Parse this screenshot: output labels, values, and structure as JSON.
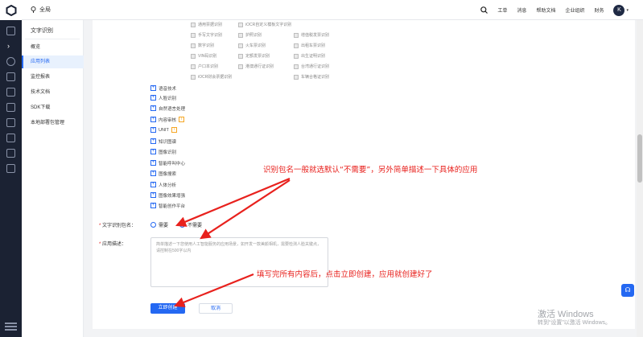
{
  "topbar": {
    "region": "全局",
    "nav": [
      "工单",
      "消息",
      "帮助文档",
      "企业组织",
      "财务"
    ],
    "avatar": "K"
  },
  "sidemenu": {
    "title": "文字识别",
    "items": [
      {
        "label": "概览",
        "active": false
      },
      {
        "label": "应用列表",
        "active": true
      },
      {
        "label": "监控报表",
        "active": false
      },
      {
        "label": "技术文档",
        "active": false
      },
      {
        "label": "SDK下载",
        "active": false
      },
      {
        "label": "本地部署包管理",
        "active": false
      }
    ]
  },
  "ocr_options": [
    [
      "通用票据识别",
      "iOCR自定义模板文字识别"
    ],
    [
      "手写文字识别",
      "护照识别",
      "增值税发票识别"
    ],
    [
      "数字识别",
      "火车票识别",
      "出租车票识别"
    ],
    [
      "VIN码识别",
      "定额发票识别",
      "出生证明识别"
    ],
    [
      "户口本识别",
      "港澳通行证识别",
      "台湾通行证识别"
    ],
    [
      "iOCR财会票据识别",
      "",
      "车辆合格证识别"
    ]
  ],
  "tree_items": [
    {
      "label": "语音技术",
      "tag": ""
    },
    {
      "label": "人脸识别",
      "tag": ""
    },
    {
      "label": "自然语言处理",
      "tag": ""
    },
    {
      "label": "内容审核",
      "tag": "i"
    },
    {
      "label": "UNIT",
      "tag": "i"
    },
    {
      "label": "知识图谱",
      "tag": ""
    },
    {
      "label": "图像识别",
      "tag": ""
    },
    {
      "label": "智能呼叫中心",
      "tag": ""
    },
    {
      "label": "图像搜索",
      "tag": ""
    },
    {
      "label": "人体分析",
      "tag": ""
    },
    {
      "label": "图像效果增强",
      "tag": ""
    },
    {
      "label": "智能创作平台",
      "tag": ""
    }
  ],
  "form": {
    "package_label": "文字识别包名：",
    "package_required": "*",
    "radio_need": "需要",
    "radio_noneed": "不需要",
    "desc_label": "应用描述：",
    "desc_required": "*",
    "desc_placeholder": "简单描述一下您使用人工智能服务的应用场景，如开发一款美颜相机，需要检测人脸关键点，请控制在500字以内",
    "submit": "立即创建",
    "cancel": "取消"
  },
  "annotations": {
    "note1": "识别包名一般就选默认“不需要”，另外简单描述一下具体的应用",
    "note2": "填写完所有内容后，点击立即创建，应用就创建好了"
  },
  "watermark": {
    "line1": "激活 Windows",
    "line2": "转到“设置”以激活 Windows。"
  },
  "colors": {
    "accent": "#2468f2",
    "annotation": "#e8211d"
  }
}
